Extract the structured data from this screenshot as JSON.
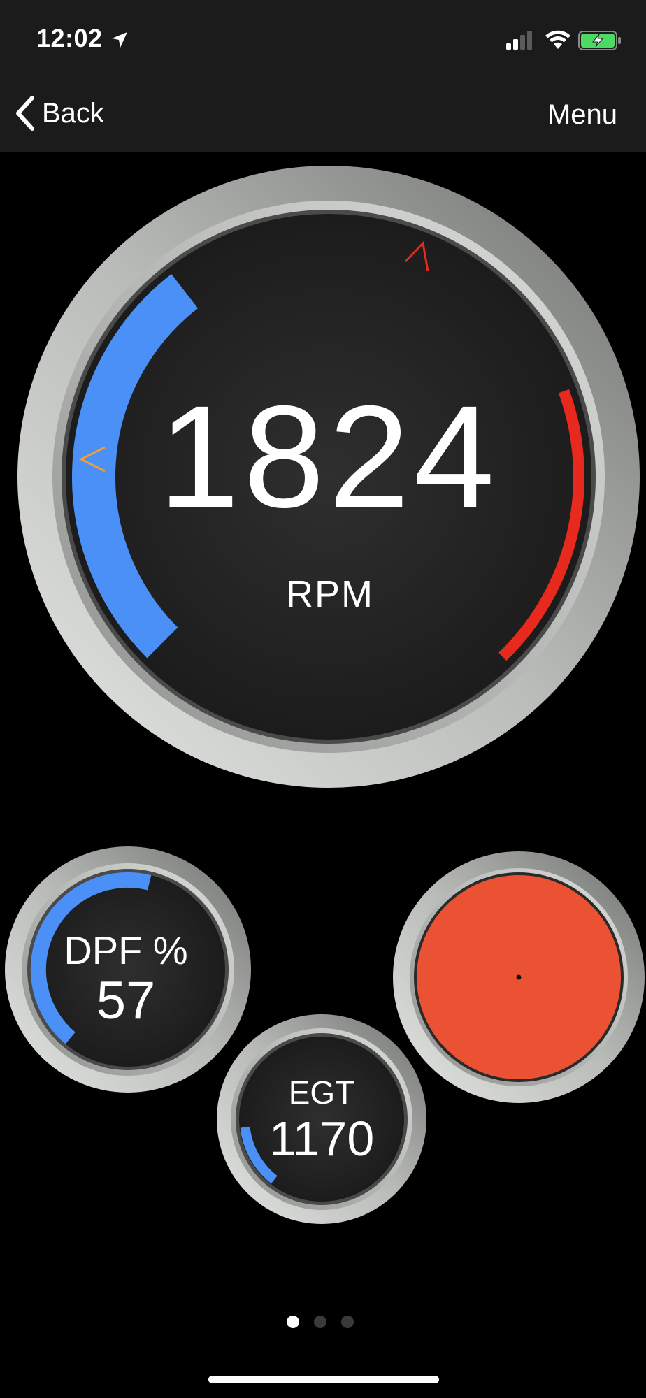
{
  "status_bar": {
    "time": "12:02",
    "icons": [
      "location-arrow-icon",
      "cellular-signal-icon",
      "wifi-icon",
      "battery-charging-icon"
    ]
  },
  "nav": {
    "back_label": "Back",
    "menu_label": "Menu"
  },
  "gauges": {
    "rpm": {
      "value": "1824",
      "unit": "RPM",
      "level": 0.36,
      "accent": "#4a90f7",
      "redline": "#e8291d"
    },
    "dpf": {
      "label": "DPF %",
      "value": "57",
      "level": 0.57,
      "accent": "#4a90f7"
    },
    "egt": {
      "label": "EGT",
      "value": "1170",
      "level": 0.17,
      "accent": "#4a90f7"
    },
    "warning": {
      "color": "#ea5233"
    }
  },
  "markers": {
    "orange": "#f0a030",
    "red": "#e8291d"
  },
  "pagination": {
    "total": 3,
    "current": 1
  }
}
